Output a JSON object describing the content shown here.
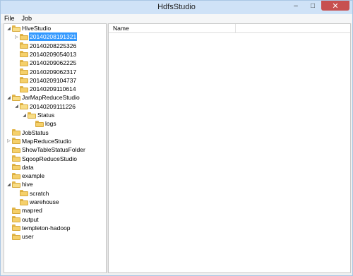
{
  "window": {
    "title": "HdfsStudio"
  },
  "menu": [
    "File",
    "Job"
  ],
  "list": {
    "columns": [
      "Name"
    ]
  },
  "tree": [
    {
      "label": "HiveStudio",
      "level": 0,
      "expander": "expanded",
      "open": true
    },
    {
      "label": "20140208191321",
      "level": 1,
      "expander": "collapsed",
      "open": false,
      "selected": true
    },
    {
      "label": "20140208225326",
      "level": 1,
      "expander": "none",
      "open": false
    },
    {
      "label": "20140209054013",
      "level": 1,
      "expander": "none",
      "open": false
    },
    {
      "label": "20140209062225",
      "level": 1,
      "expander": "none",
      "open": false
    },
    {
      "label": "20140209062317",
      "level": 1,
      "expander": "none",
      "open": false
    },
    {
      "label": "20140209104737",
      "level": 1,
      "expander": "none",
      "open": false
    },
    {
      "label": "20140209110614",
      "level": 1,
      "expander": "none",
      "open": false
    },
    {
      "label": "JarMapReduceStudio",
      "level": 0,
      "expander": "expanded",
      "open": true
    },
    {
      "label": "20140209111226",
      "level": 1,
      "expander": "expanded",
      "open": true
    },
    {
      "label": "Status",
      "level": 2,
      "expander": "expanded",
      "open": true
    },
    {
      "label": "logs",
      "level": 3,
      "expander": "none",
      "open": false
    },
    {
      "label": "JobStatus",
      "level": 0,
      "expander": "none",
      "open": false
    },
    {
      "label": "MapReduceStudio",
      "level": 0,
      "expander": "collapsed",
      "open": false
    },
    {
      "label": "ShowTableStatusFolder",
      "level": 0,
      "expander": "none",
      "open": false
    },
    {
      "label": "SqoopReduceStudio",
      "level": 0,
      "expander": "none",
      "open": false
    },
    {
      "label": "data",
      "level": 0,
      "expander": "none",
      "open": false
    },
    {
      "label": "example",
      "level": 0,
      "expander": "none",
      "open": false
    },
    {
      "label": "hive",
      "level": 0,
      "expander": "expanded",
      "open": true
    },
    {
      "label": "scratch",
      "level": 1,
      "expander": "none",
      "open": false
    },
    {
      "label": "warehouse",
      "level": 1,
      "expander": "none",
      "open": false
    },
    {
      "label": "mapred",
      "level": 0,
      "expander": "none",
      "open": false
    },
    {
      "label": "output",
      "level": 0,
      "expander": "none",
      "open": false
    },
    {
      "label": "templeton-hadoop",
      "level": 0,
      "expander": "none",
      "open": false
    },
    {
      "label": "user",
      "level": 0,
      "expander": "none",
      "open": false
    }
  ],
  "colors": {
    "titlebar": "#cfe2f7",
    "close": "#c75050",
    "selection": "#3399ff",
    "folder": "#f5d06b"
  },
  "icons": {
    "minimize": "minimize-icon",
    "maximize": "maximize-icon",
    "close": "close-icon",
    "folder": "folder-icon"
  }
}
